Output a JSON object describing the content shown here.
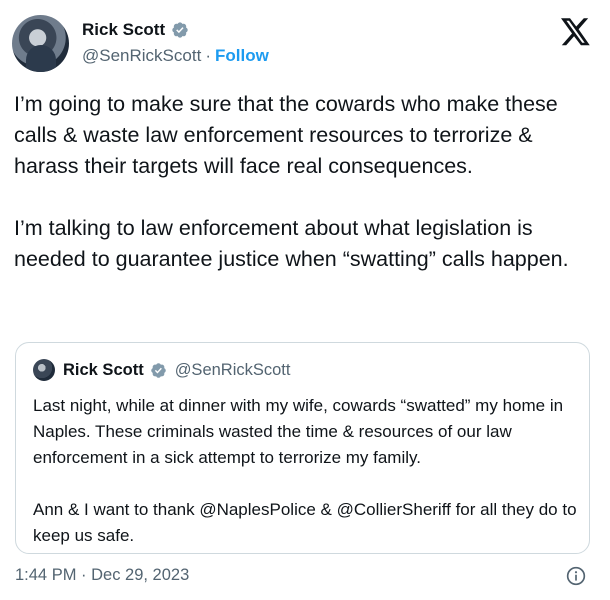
{
  "author": {
    "name": "Rick Scott",
    "handle": "@SenRickScott",
    "separator": "·",
    "follow_label": "Follow"
  },
  "tweet": {
    "text": "I’m going to make sure that the cowards who make these calls & waste law enforcement resources to terrorize & harass their targets will face real consequences.\n\nI’m talking to law enforcement about what legislation is needed to guarantee justice when “swatting” calls happen.",
    "timestamp": "1:44 PM · Dec 29, 2023"
  },
  "quote": {
    "name": "Rick Scott",
    "handle": "@SenRickScott",
    "text": "Last night, while at dinner with my wife, cowards “swatted” my home in Naples. These criminals wasted the time & resources of our law enforcement in a sick attempt to terrorize my family.\n\nAnn & I want to thank @NaplesPolice & @CollierSheriff for all they do to keep us safe."
  },
  "icons": {
    "verified": "verified-badge-icon",
    "platform": "x-logo-icon",
    "info": "info-icon"
  },
  "colors": {
    "accent": "#1d9bf0",
    "text": "#0f1419",
    "secondary_text": "#536471",
    "border": "#cfd9de"
  }
}
